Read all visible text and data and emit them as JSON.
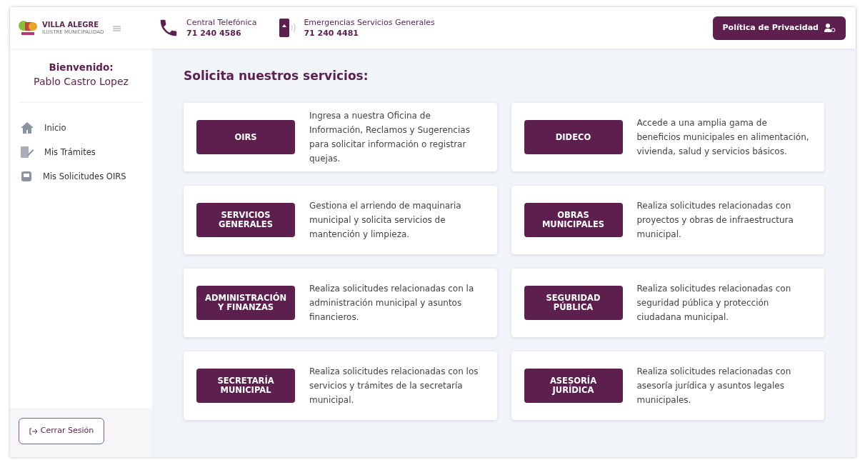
{
  "header": {
    "logo_name": "VILLA ALEGRE",
    "logo_subtitle": "ILUSTRE MUNICIPALIDAD",
    "contacts": [
      {
        "kind": "phone",
        "label": "Central Telefónica",
        "number": "71 240 4586"
      },
      {
        "kind": "mobile",
        "label": "Emergencias Servicios Generales",
        "number": "71 240 4481"
      }
    ],
    "privacy_button": "Política de Privacidad"
  },
  "sidebar": {
    "greeting": "Bienvenido:",
    "user_name": "Pablo Castro Lopez",
    "items": [
      {
        "kind": "home",
        "label": "Inicio"
      },
      {
        "kind": "docs",
        "label": "Mis Trámites"
      },
      {
        "kind": "inbox",
        "label": "Mis Solicitudes OIRS"
      }
    ],
    "logout_button": "Cerrar Sesión"
  },
  "main": {
    "title": "Solicita nuestros servicios:",
    "services": [
      {
        "button": "OIRS",
        "description": "Ingresa a nuestra Oficina de Información, Reclamos y Sugerencias para solicitar información o registrar quejas."
      },
      {
        "button": "DIDECO",
        "description": "Accede a una amplia gama de beneficios municipales en alimentación, vivienda, salud y servicios básicos."
      },
      {
        "button": "SERVICIOS GENERALES",
        "description": "Gestiona el arriendo de maquinaria municipal y solicita servicios de mantención y limpieza."
      },
      {
        "button": "OBRAS MUNICIPALES",
        "description": "Realiza solicitudes relacionadas con proyectos y obras de infraestructura municipal."
      },
      {
        "button": "ADMINISTRACIÓN Y FINANZAS",
        "description": "Realiza solicitudes relacionadas con la administración municipal y asuntos financieros."
      },
      {
        "button": "SEGURIDAD PÚBLICA",
        "description": "Realiza solicitudes relacionadas con seguridad pública y protección ciudadana municipal."
      },
      {
        "button": "SECRETARÍA MUNICIPAL",
        "description": "Realiza solicitudes relacionadas con los servicios y trámites de la secretaría municipal."
      },
      {
        "button": "ASESORÍA JURÍDICA",
        "description": "Realiza solicitudes relacionadas con asesoría jurídica y asuntos legales municipales."
      }
    ]
  }
}
